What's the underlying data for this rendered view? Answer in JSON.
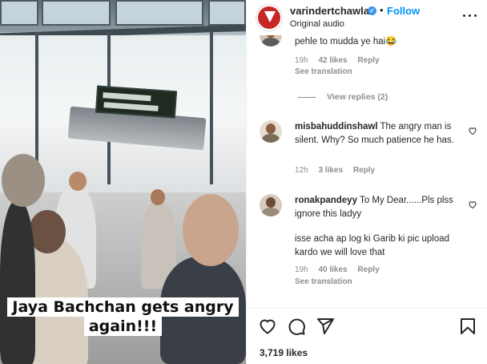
{
  "video": {
    "caption_line1": "Jaya Bachchan gets angry",
    "caption_line2": "again!!!"
  },
  "post": {
    "username": "varindertchawla",
    "separator": "•",
    "follow_label": "Follow",
    "audio_label": "Original audio",
    "likes_count": "3,719 likes"
  },
  "comments": [
    {
      "username": "",
      "text": "pehle to mudda ye hai😂",
      "time": "19h",
      "likes": "42 likes",
      "reply_label": "Reply",
      "see_translation": "See translation",
      "view_replies": "View replies (2)"
    },
    {
      "username": "misbahuddinshawl",
      "text": "The angry man is silent. Why? So much patience he has.",
      "time": "12h",
      "likes": "3 likes",
      "reply_label": "Reply"
    },
    {
      "username": "ronakpandeyy",
      "text": "To My Dear......Pls plss ignore this ladyy",
      "text2": "isse acha ap log ki Garib ki pic upload kardo we will love that",
      "time": "19h",
      "likes": "40 likes",
      "reply_label": "Reply",
      "see_translation": "See translation"
    }
  ],
  "icons": [
    "heart-icon",
    "comment-icon",
    "share-icon",
    "bookmark-icon",
    "more-icon",
    "verified-icon"
  ],
  "colors": {
    "follow": "#0095f6",
    "verified": "#3897f0",
    "brand_avatar": "#c62828",
    "meta": "#8e8e8e"
  }
}
